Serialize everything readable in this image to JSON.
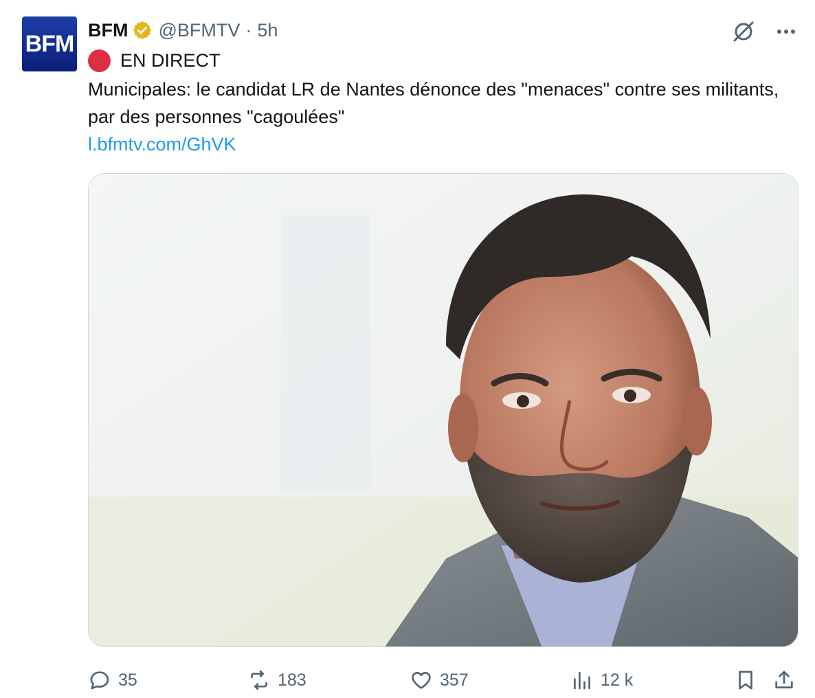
{
  "author": {
    "avatar_text": "BFM",
    "name": "BFM",
    "handle": "@BFMTV",
    "separator": "·",
    "time": "5h",
    "verified_color": "#e2b719"
  },
  "tweet": {
    "live_label": "EN DIRECT",
    "text": "Municipales: le candidat LR de Nantes dénonce des \"menaces\" contre ses militants, par des personnes \"cagoulées\"",
    "link": "l.bfmtv.com/GhVK"
  },
  "media": {
    "alt": "photo-of-man"
  },
  "actions": {
    "replies": "35",
    "retweets": "183",
    "likes": "357",
    "views": "12 k"
  },
  "colors": {
    "accent": "#1d9bf0",
    "muted": "#536471",
    "live_dot": "#dd2e44",
    "avatar_bg": "#0b1f7a"
  },
  "icons": [
    "grok-icon",
    "more-icon",
    "reply-icon",
    "retweet-icon",
    "like-icon",
    "views-icon",
    "bookmark-icon",
    "share-icon"
  ]
}
